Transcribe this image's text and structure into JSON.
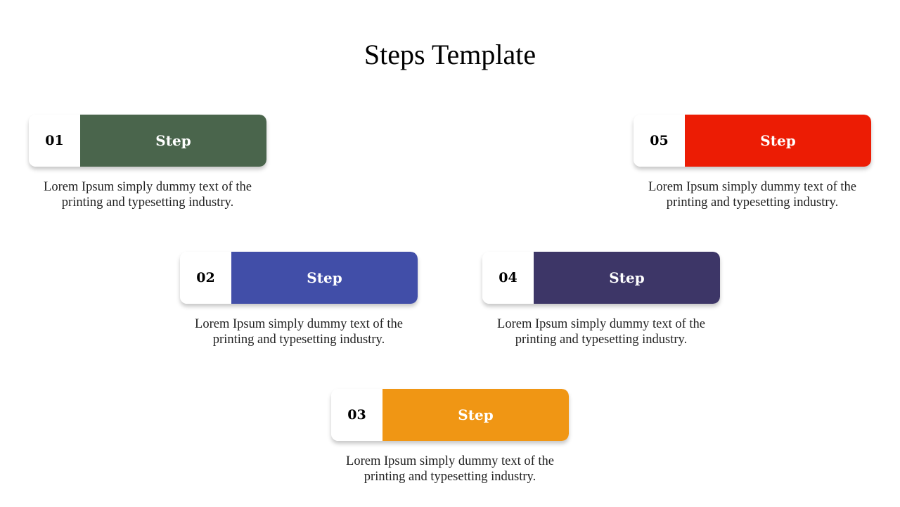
{
  "title": "Steps Template",
  "steps": [
    {
      "number": "01",
      "label": "Step",
      "color": "#4a654c",
      "description": "Lorem Ipsum simply dummy text of the printing and typesetting industry."
    },
    {
      "number": "02",
      "label": "Step",
      "color": "#414ea8",
      "description": "Lorem Ipsum simply dummy text of the printing and typesetting industry."
    },
    {
      "number": "03",
      "label": "Step",
      "color": "#f09614",
      "description": "Lorem Ipsum simply dummy text of the printing and typesetting industry."
    },
    {
      "number": "04",
      "label": "Step",
      "color": "#3d3667",
      "description": "Lorem Ipsum simply dummy text of the printing and typesetting industry."
    },
    {
      "number": "05",
      "label": "Step",
      "color": "#ec1c04",
      "description": "Lorem Ipsum simply dummy text of the printing and typesetting industry."
    }
  ]
}
